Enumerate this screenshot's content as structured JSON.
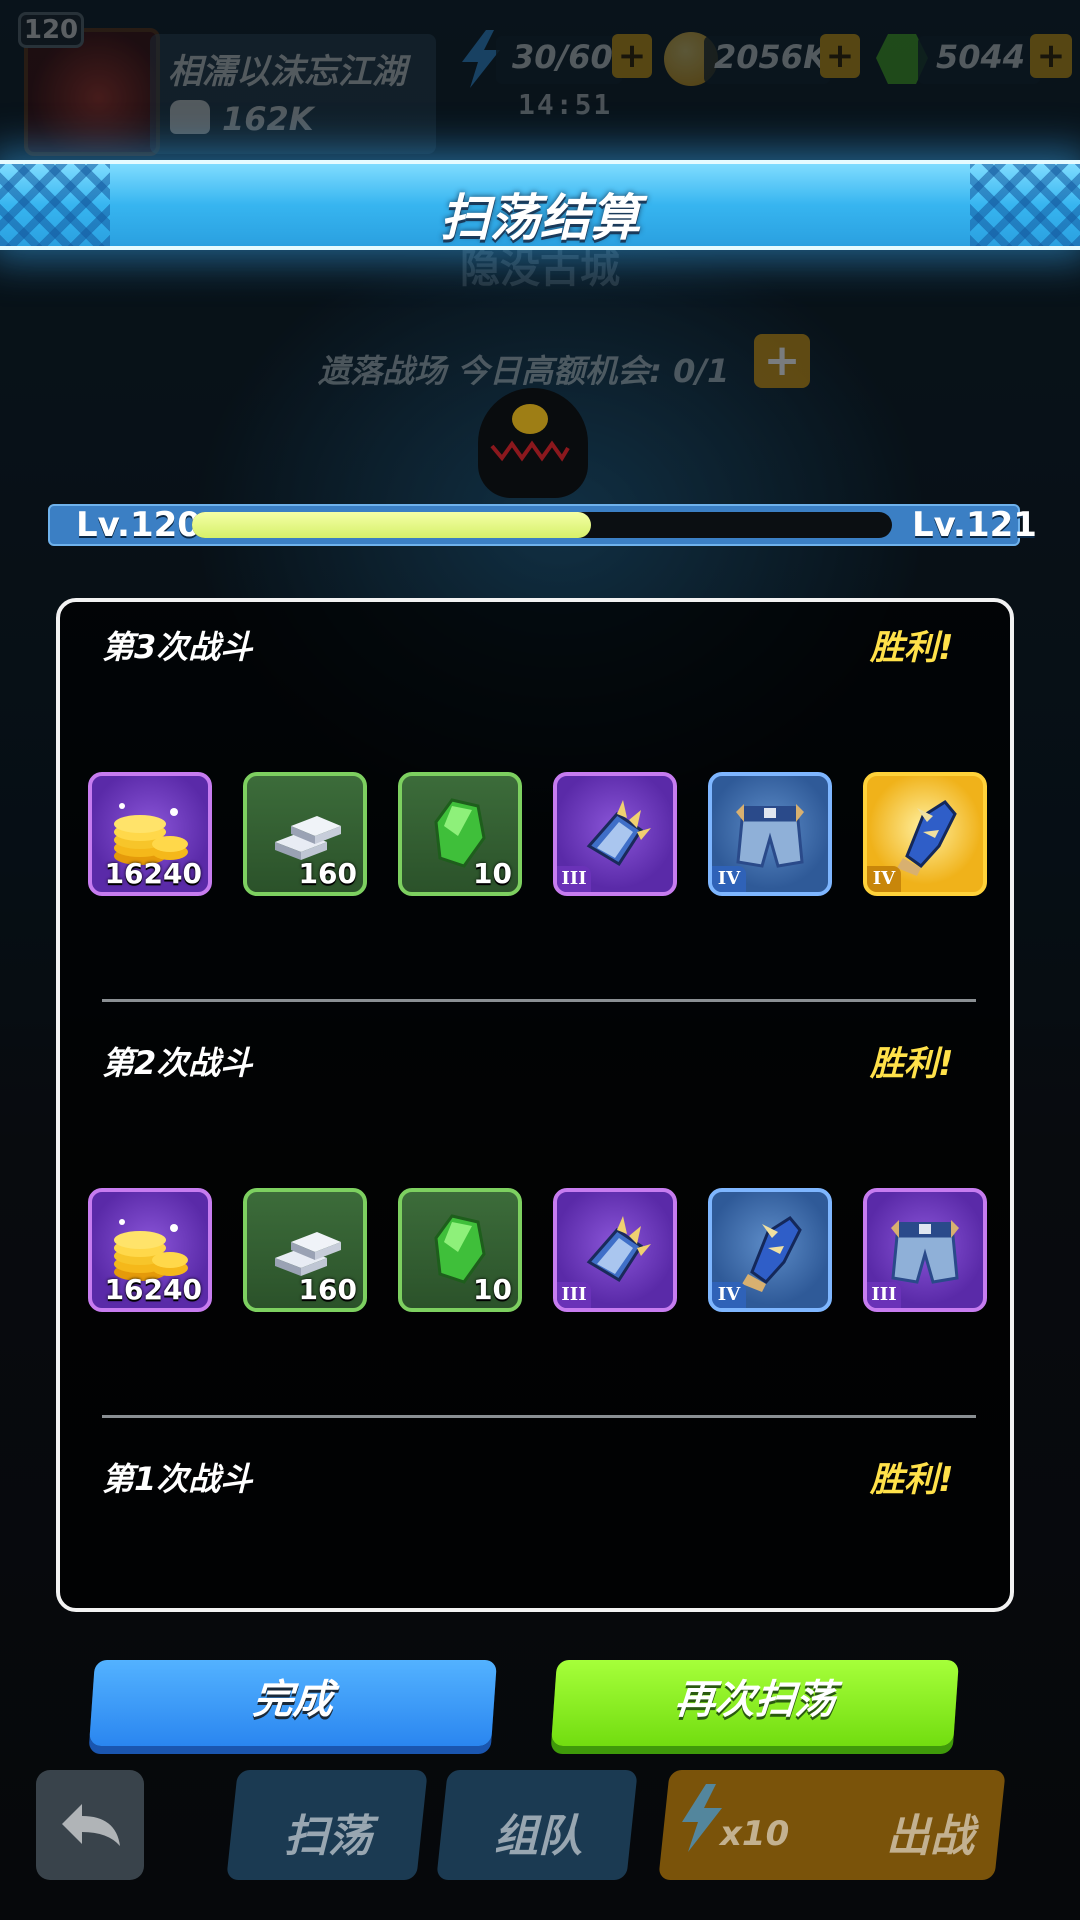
{
  "player": {
    "level": "120",
    "name": "相濡以沫忘江湖",
    "power": "162K"
  },
  "resources": {
    "energy": "30/60",
    "gold": "2056K",
    "gems": "5044",
    "timer": "14:51"
  },
  "banner": {
    "title": "扫荡结算"
  },
  "stage": {
    "name": "隐没古城",
    "chance_text": "遗落战场 今日高额机会: 0/1"
  },
  "level_bar": {
    "current": "Lv.120",
    "next": "Lv.121",
    "progress": 0.57
  },
  "rounds": [
    {
      "title": "第3次战斗",
      "result": "胜利!",
      "items": [
        {
          "icon": "gold-coins-icon",
          "rarity": "purple",
          "qty": "16240",
          "tier": ""
        },
        {
          "icon": "silver-ingot-icon",
          "rarity": "green",
          "qty": "160",
          "tier": ""
        },
        {
          "icon": "green-crystal-icon",
          "rarity": "green",
          "qty": "10",
          "tier": ""
        },
        {
          "icon": "spiked-gauntlet-icon",
          "rarity": "purple",
          "qty": "",
          "tier": "III"
        },
        {
          "icon": "armor-pants-icon",
          "rarity": "blue",
          "qty": "",
          "tier": "IV"
        },
        {
          "icon": "spiked-glove-icon",
          "rarity": "gold",
          "qty": "",
          "tier": "IV"
        }
      ]
    },
    {
      "title": "第2次战斗",
      "result": "胜利!",
      "items": [
        {
          "icon": "gold-coins-icon",
          "rarity": "purple",
          "qty": "16240",
          "tier": ""
        },
        {
          "icon": "silver-ingot-icon",
          "rarity": "green",
          "qty": "160",
          "tier": ""
        },
        {
          "icon": "green-crystal-icon",
          "rarity": "green",
          "qty": "10",
          "tier": ""
        },
        {
          "icon": "spiked-gauntlet-icon",
          "rarity": "purple",
          "qty": "",
          "tier": "III"
        },
        {
          "icon": "spiked-glove-icon",
          "rarity": "blue",
          "qty": "",
          "tier": "IV"
        },
        {
          "icon": "armor-pants-icon",
          "rarity": "purple",
          "qty": "",
          "tier": "III"
        }
      ]
    },
    {
      "title": "第1次战斗",
      "result": "胜利!",
      "items": []
    }
  ],
  "buttons": {
    "done": "完成",
    "sweep_again": "再次扫荡"
  },
  "bottom_bar": {
    "sweep": "扫荡",
    "team": "组队",
    "energy_cost": "x10",
    "battle": "出战"
  },
  "colors": {
    "accent_blue": "#37b5f0",
    "victory_yellow": "#ffe14a",
    "done_blue": "#2a86f0",
    "again_green": "#72dd10"
  }
}
